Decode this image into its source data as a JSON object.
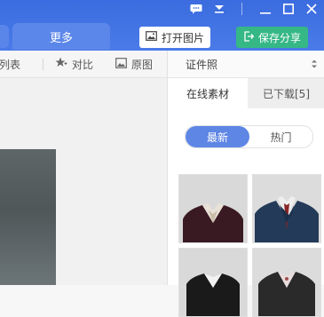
{
  "header": {
    "more_tab_label": "更多",
    "open_image_label": "打开图片",
    "save_share_label": "保存分享"
  },
  "toolbar": {
    "list_label": "图列表",
    "compare_label": "对比",
    "original_label": "原图"
  },
  "panel": {
    "select_value": "证件照",
    "tabs": [
      {
        "label": "在线素材"
      },
      {
        "label": "已下载[5]"
      }
    ],
    "filters": [
      {
        "label": "最新"
      },
      {
        "label": "热门"
      }
    ]
  },
  "colors": {
    "titlebar": "#3d6fe0",
    "save_button": "#35b786",
    "active_pill": "#5e86e5"
  }
}
